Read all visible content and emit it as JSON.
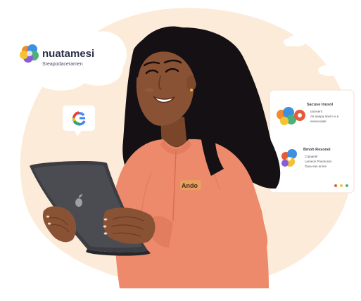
{
  "brand_bubble": {
    "title": "nuatamesi",
    "subtitle": "Sreapodaceramen"
  },
  "card_one": {
    "title": "Sacuse Inusol",
    "line1": "Iacesent",
    "line2": "Alr aanpa anel e e e",
    "line3": "eeneuraale"
  },
  "card_two": {
    "title": "Bmoh Resonel",
    "line1": "Crpaanel",
    "line2": "Lemeon Pnemunal",
    "line3": "Taua ean anme"
  },
  "shirt_logo_text": "Ando",
  "colors": {
    "blob": "#FCEBD8",
    "shirt": "#EE8A6C",
    "skin": "#8A5234",
    "hair": "#141014",
    "tablet": "#3B3D42"
  }
}
